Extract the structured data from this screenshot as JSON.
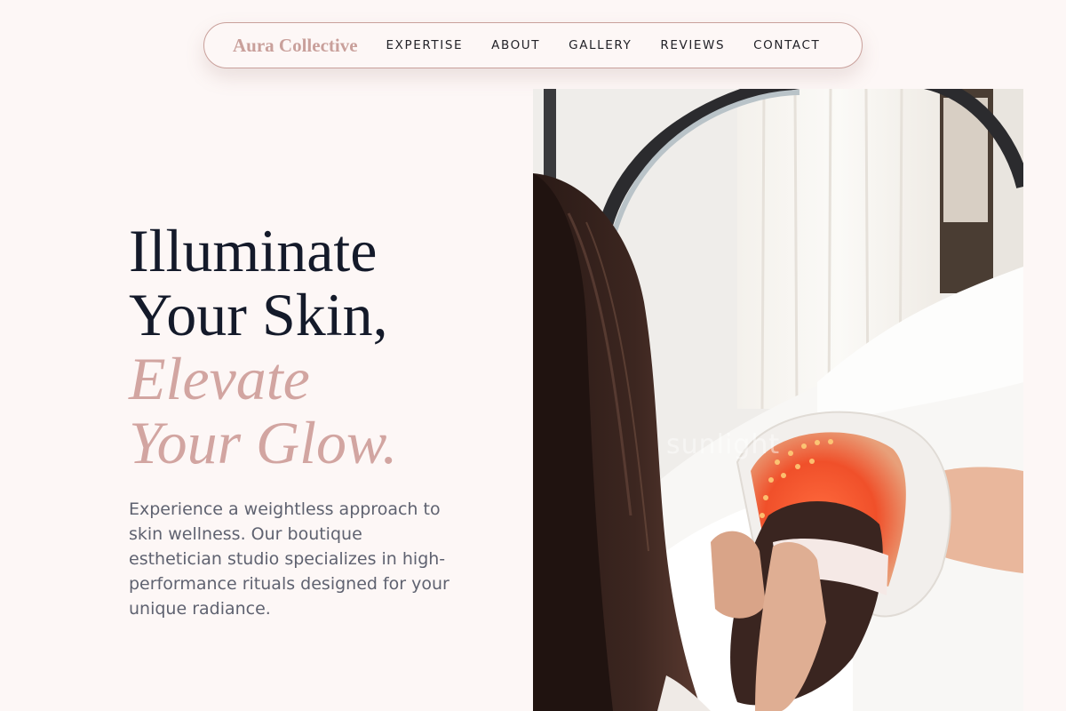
{
  "nav": {
    "brand": "Aura Collective",
    "links": [
      "EXPERTISE",
      "ABOUT",
      "GALLERY",
      "REVIEWS",
      "CONTACT"
    ]
  },
  "hero": {
    "title_line1": "Illuminate",
    "title_line2": "Your Skin,",
    "accent_line1": "Elevate",
    "accent_line2": "Your Glow.",
    "description": "Experience a weightless approach to skin wellness. Our boutique esthetician studio specializes in high-performance rituals designed for your unique radiance.",
    "image_watermark": "sunlight"
  },
  "colors": {
    "background": "#fdf7f6",
    "brand_accent": "#c9a09b",
    "heading": "#141a2a",
    "body_text": "#5f6270"
  }
}
